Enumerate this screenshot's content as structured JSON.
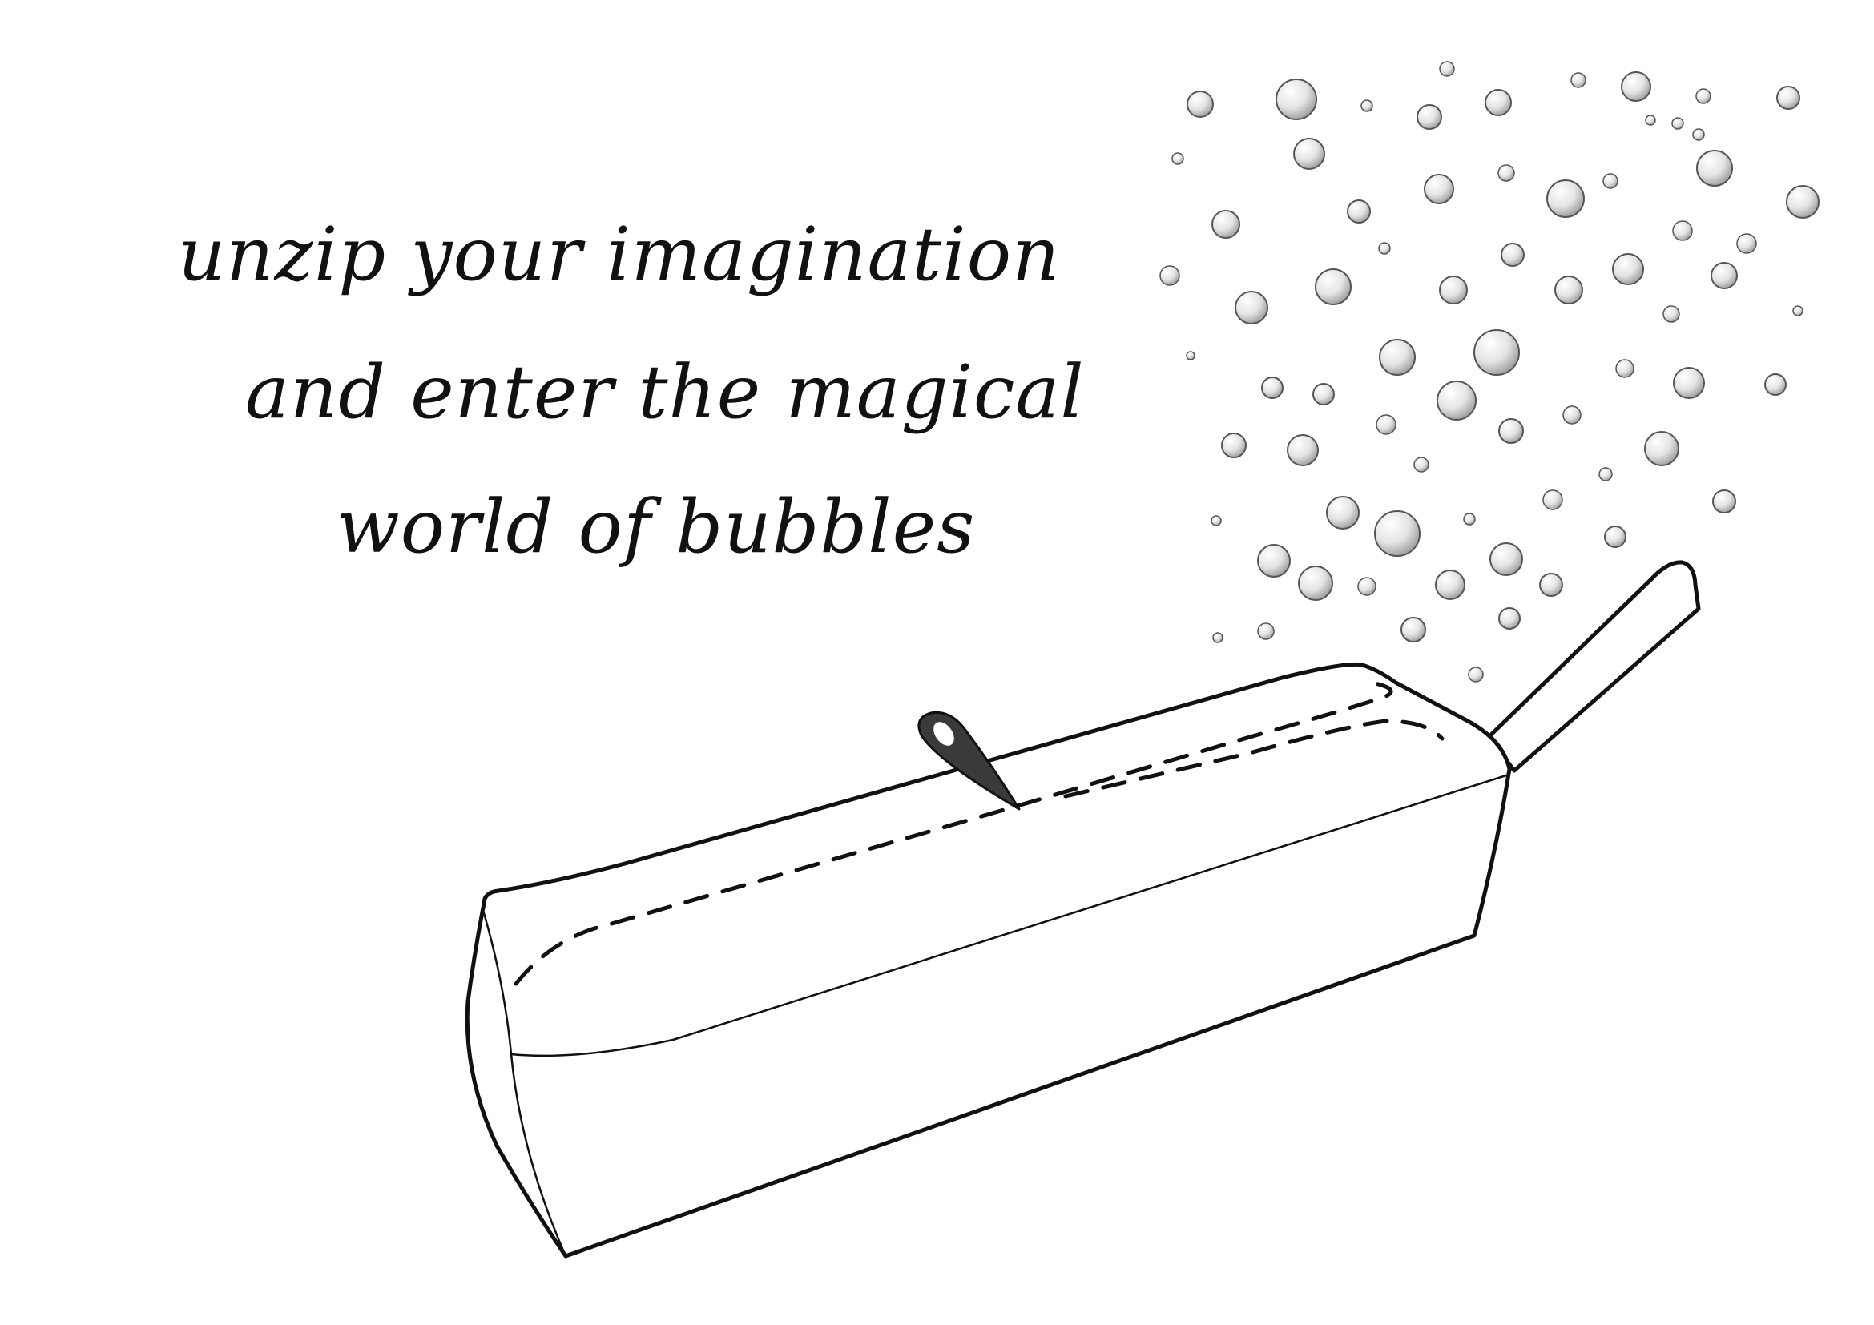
{
  "caption": {
    "line1": "unzip your imagination",
    "line2": "and enter the magical",
    "line3": "world of bubbles"
  },
  "colors": {
    "ink": "#111111",
    "background": "#ffffff",
    "bubble_light": "#ffffff",
    "bubble_shade": "#9a9a9a",
    "zipper_pull": "#3a3a3a"
  },
  "illustration": {
    "subject": "pencil-case",
    "bubble_count": 71
  }
}
